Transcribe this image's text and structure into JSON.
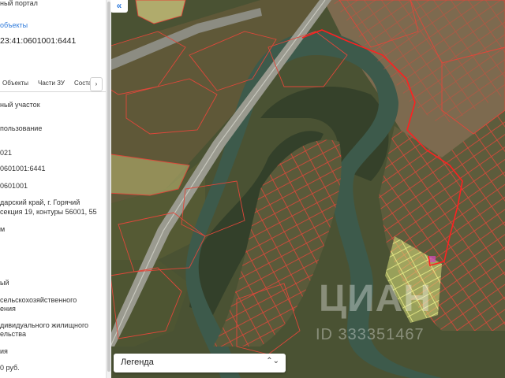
{
  "panel": {
    "portal_title": "ный портал",
    "objects_link": "объекты",
    "cadastral_number": "23:41:0601001:6441",
    "tabs": [
      "Объекты",
      "Части ЗУ",
      "Соста"
    ],
    "tab_next": "›",
    "lines": [
      "ный участок",
      "пользование",
      "021",
      "0601001:6441",
      "0601001",
      "дарский край, г. Горячий",
      "секция 19, контуры 56001, 55",
      "м",
      "ый",
      "сельскохозяйственного",
      "ения",
      "дивидуального жилищного",
      "ельства",
      "ия",
      "0 руб."
    ]
  },
  "collapse_icon": "«",
  "legend": {
    "label": "Легенда",
    "chevron": "⌃⌄"
  },
  "watermark": {
    "brand": "ЦИАН",
    "id": "ID 333351467"
  },
  "colors": {
    "parcel_border": "#e0473a",
    "selected_border": "#ff2020",
    "highlight_fill": "#d8e07a",
    "river": "#3d5a4b"
  }
}
